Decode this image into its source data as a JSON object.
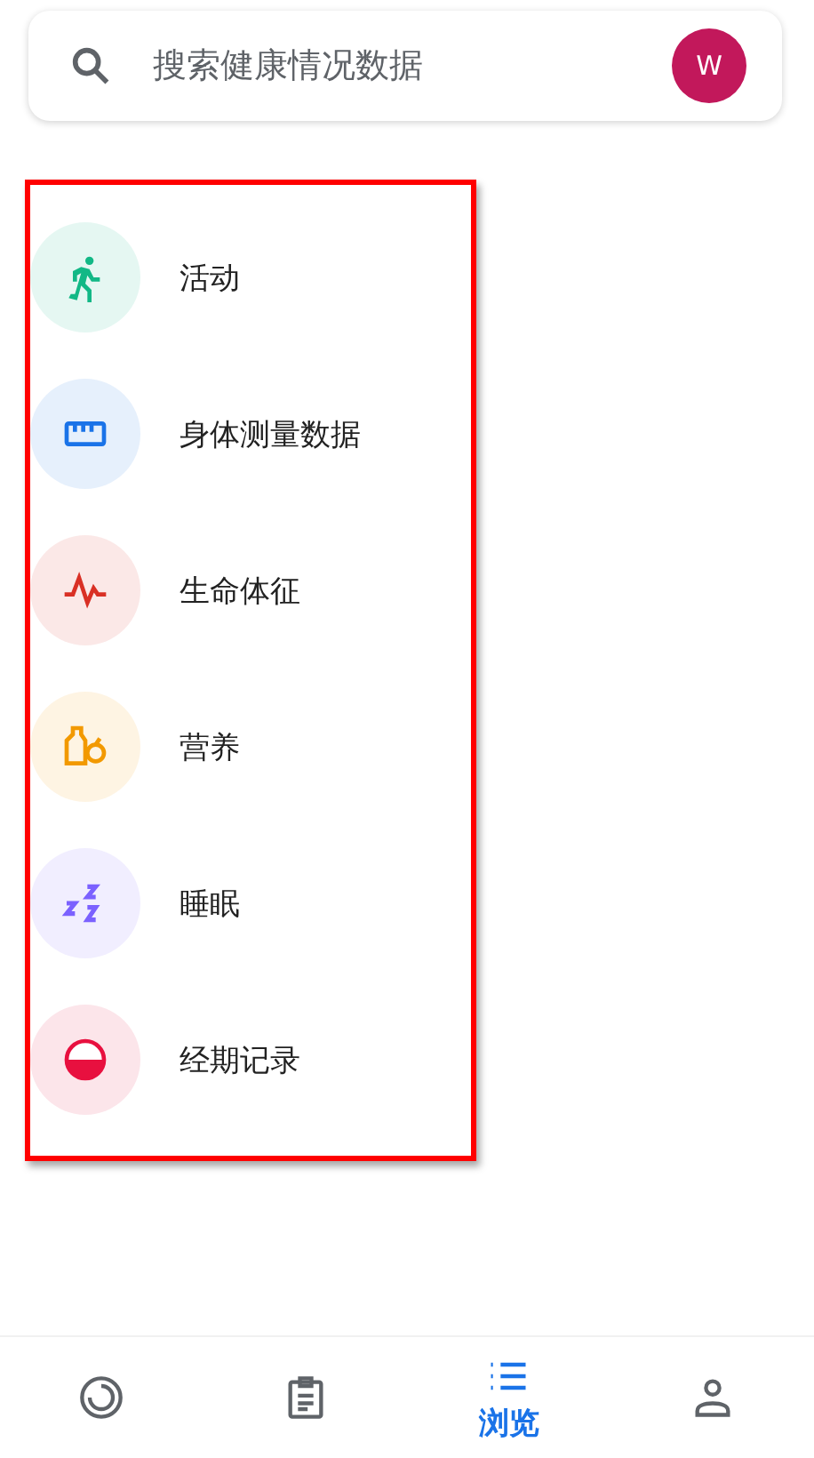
{
  "search": {
    "placeholder": "搜索健康情况数据",
    "avatar": "W"
  },
  "categories": [
    {
      "kind": "activity",
      "label": "活动",
      "color": "#12b886"
    },
    {
      "kind": "measurement",
      "label": "身体测量数据",
      "color": "#1a73e8"
    },
    {
      "kind": "vitals",
      "label": "生命体征",
      "color": "#d93025"
    },
    {
      "kind": "nutrition",
      "label": "营养",
      "color": "#f29900"
    },
    {
      "kind": "sleep",
      "label": "睡眠",
      "color": "#7b61ff"
    },
    {
      "kind": "cycle",
      "label": "经期记录",
      "color": "#e8103f"
    }
  ],
  "nav": [
    {
      "kind": "home",
      "selected": false
    },
    {
      "kind": "journal",
      "selected": false
    },
    {
      "kind": "browse",
      "label": "浏览",
      "selected": true
    },
    {
      "kind": "profile",
      "selected": false
    }
  ]
}
